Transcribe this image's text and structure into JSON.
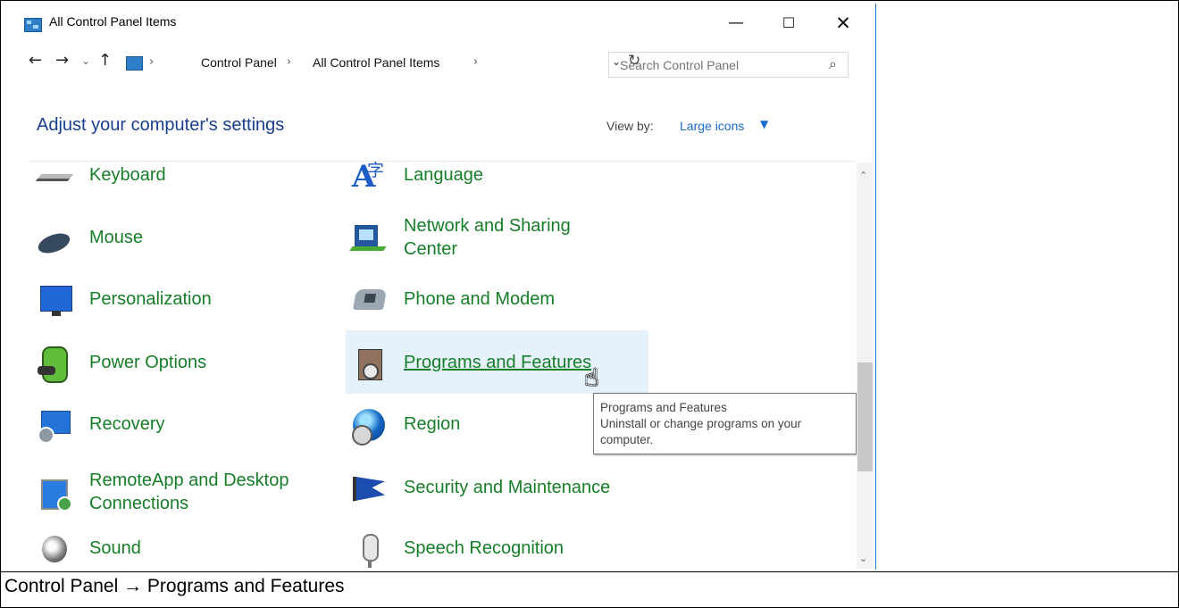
{
  "window": {
    "title": "All Control Panel Items",
    "controls": [
      "—",
      "☐",
      "✕"
    ]
  },
  "nav": {
    "back_icon": "←",
    "forward_icon": "→",
    "recent_icon": "⌄",
    "up_icon": "↑",
    "breadcrumb": [
      "Control Panel",
      "All Control Panel Items"
    ],
    "separator": "›",
    "dropdown_icon": "⌄",
    "refresh_icon": "↻"
  },
  "search": {
    "placeholder": "Search Control Panel",
    "icon": "⌕"
  },
  "header": {
    "title": "Adjust your computer's settings",
    "view_by_label": "View by:",
    "view_by_value": "Large icons",
    "view_by_caret": "▼"
  },
  "items": {
    "keyboard": "Keyboard",
    "mouse": "Mouse",
    "personalization": "Personalization",
    "power_options": "Power Options",
    "recovery": "Recovery",
    "remoteapp": "RemoteApp and Desktop Connections",
    "sound": "Sound",
    "language": "Language",
    "network": "Network and Sharing Center",
    "phone": "Phone and Modem",
    "programs": "Programs and Features",
    "region": "Region",
    "security": "Security and Maintenance",
    "speech": "Speech Recognition"
  },
  "tooltip": {
    "title": "Programs and Features",
    "description": "Uninstall or change programs on your computer."
  },
  "scrollbar": {
    "up_icon": "⌃",
    "down_icon": "⌄"
  },
  "caption": "Control Panel → Programs and Features"
}
